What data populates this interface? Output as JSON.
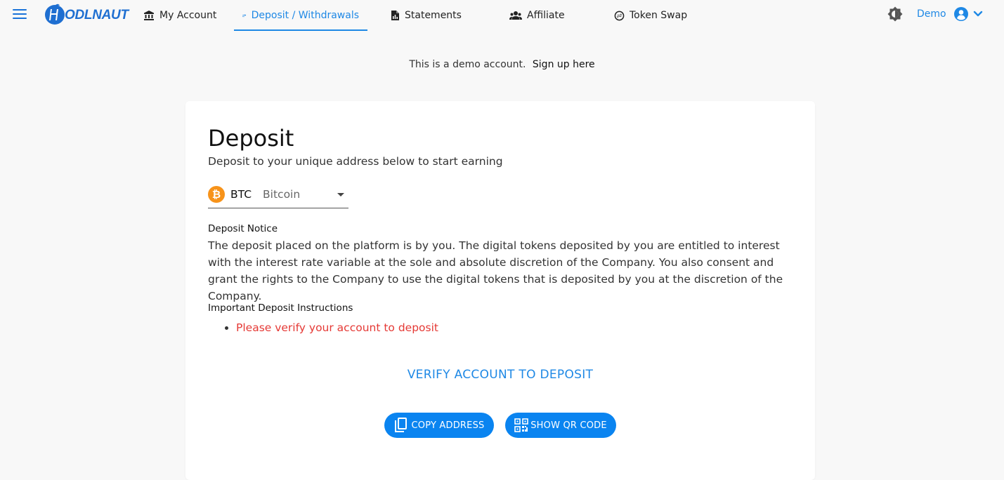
{
  "nav": {
    "brand": "ODLNAUT",
    "items": [
      {
        "label": "My Account",
        "icon": "bank-icon"
      },
      {
        "label": "Deposit / Withdrawals",
        "icon": "transfer-icon",
        "active": true
      },
      {
        "label": "Statements",
        "icon": "document-icon"
      },
      {
        "label": "Affiliate",
        "icon": "people-icon"
      },
      {
        "label": "Token Swap",
        "icon": "swap-icon"
      }
    ],
    "user": "Demo"
  },
  "banner": {
    "text": "This is a demo account.",
    "link": "Sign up here"
  },
  "deposit": {
    "title": "Deposit",
    "subtitle": "Deposit to your unique address below to start earning",
    "coin": {
      "symbol": "BTC",
      "name": "Bitcoin",
      "icon_glyph": "₿",
      "color": "#f7931a"
    },
    "notice_label": "Deposit Notice",
    "notice_text": "The deposit placed on the platform is by you. The digital tokens deposited by you are entitled to interest with the interest rate variable at the sole and absolute discretion of the Company. You also consent and grant the rights to the Company to use the digital tokens that is deposited by you at the discretion of the Company.",
    "instructions_label": "Important Deposit Instructions",
    "instructions": [
      "Please verify your account to deposit"
    ],
    "verify_label": "VERIFY ACCOUNT TO DEPOSIT",
    "copy_label": "COPY ADDRESS",
    "qr_label": "SHOW QR CODE"
  },
  "colors": {
    "accent": "#1e88e5",
    "button": "#0a84f0",
    "warning": "#e53935",
    "btc": "#f7931a",
    "background": "#f8f8f8"
  }
}
